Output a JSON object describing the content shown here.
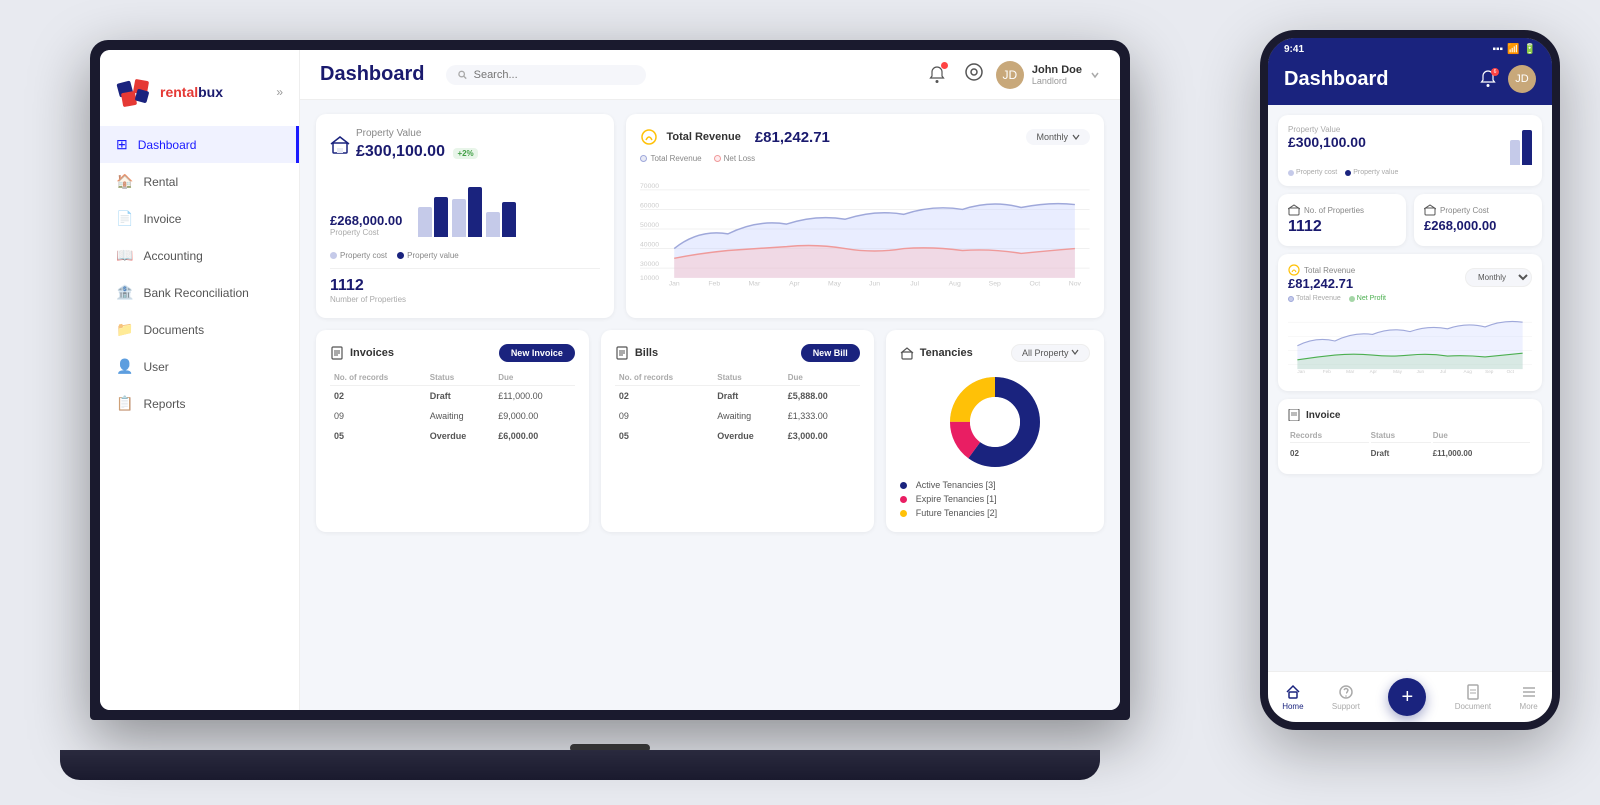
{
  "brand": {
    "name": "rentalbux",
    "logo_text": "rental"
  },
  "topbar": {
    "title": "Dashboard",
    "search_placeholder": "Search...",
    "user_name": "John Doe",
    "user_role": "Landlord"
  },
  "sidebar": {
    "items": [
      {
        "id": "dashboard",
        "label": "Dashboard",
        "icon": "⊞",
        "active": true
      },
      {
        "id": "rental",
        "label": "Rental",
        "icon": "🏠"
      },
      {
        "id": "invoice",
        "label": "Invoice",
        "icon": "📄"
      },
      {
        "id": "accounting",
        "label": "Accounting",
        "icon": "📖"
      },
      {
        "id": "bank",
        "label": "Bank Reconciliation",
        "icon": "🏦"
      },
      {
        "id": "documents",
        "label": "Documents",
        "icon": "📁"
      },
      {
        "id": "user",
        "label": "User",
        "icon": "👤"
      },
      {
        "id": "reports",
        "label": "Reports",
        "icon": "📋"
      }
    ]
  },
  "property_card": {
    "title": "Property Value",
    "value": "£300,100.00",
    "badge": "+2%",
    "cost_label": "Property Cost",
    "cost_value": "£268,000.00",
    "num_properties_label": "Number of Properties",
    "num_properties_value": "1112",
    "legend_cost": "Property cost",
    "legend_value": "Property value"
  },
  "revenue_card": {
    "title": "Total Revenue",
    "value": "£81,242.71",
    "filter": "Monthly",
    "legend_revenue": "Total Revenue",
    "legend_loss": "Net Loss",
    "months": [
      "Jan",
      "Feb",
      "Mar",
      "Apr",
      "May",
      "Jun",
      "Jul",
      "Aug",
      "Sep",
      "Oct",
      "Nov"
    ]
  },
  "invoices": {
    "title": "Invoices",
    "new_btn": "New Invoice",
    "headers": [
      "No. of records",
      "Status",
      "Due"
    ],
    "rows": [
      {
        "records": "02",
        "status": "Draft",
        "due": "£11,000.00",
        "type": "blue"
      },
      {
        "records": "09",
        "status": "Awaiting",
        "due": "£9,000.00",
        "type": "normal"
      },
      {
        "records": "05",
        "status": "Overdue",
        "due": "£6,000.00",
        "type": "red"
      }
    ]
  },
  "bills": {
    "title": "Bills",
    "new_btn": "New Bill",
    "headers": [
      "No. of records",
      "Status",
      "Due"
    ],
    "rows": [
      {
        "records": "02",
        "status": "Draft",
        "due": "£5,888.00",
        "type": "blue"
      },
      {
        "records": "09",
        "status": "Awaiting",
        "due": "£1,333.00",
        "type": "normal"
      },
      {
        "records": "05",
        "status": "Overdue",
        "due": "£3,000.00",
        "type": "red"
      }
    ]
  },
  "tenancies": {
    "title": "Tenancies",
    "filter": "All Property",
    "active_label": "Active Tenancies [3]",
    "expire_label": "Expire Tenancies [1]",
    "future_label": "Future Tenancies [2]",
    "active_color": "#1a237e",
    "expire_color": "#e91e63",
    "future_color": "#ffc107"
  },
  "phone": {
    "status_time": "9:41",
    "title": "Dashboard",
    "property_value_title": "Property Value",
    "property_value": "£300,100.00",
    "num_properties_label": "No. of Properties",
    "num_properties_value": "1112",
    "property_cost_label": "Property Cost",
    "property_cost_value": "£268,000.00",
    "revenue_label": "Total Revenue",
    "revenue_value": "£81,242.71",
    "chart_filter": "Monthly",
    "chart_legend_revenue": "Total Revenue",
    "chart_legend_profit": "Net Profit",
    "invoice_title": "Invoice",
    "invoice_headers": [
      "Records",
      "Status",
      "Due"
    ],
    "invoice_rows": [
      {
        "records": "02",
        "status": "Draft",
        "due": "£11,000.00",
        "type": "blue"
      }
    ],
    "nav_items": [
      "Home",
      "Support",
      "Document",
      "More"
    ]
  }
}
